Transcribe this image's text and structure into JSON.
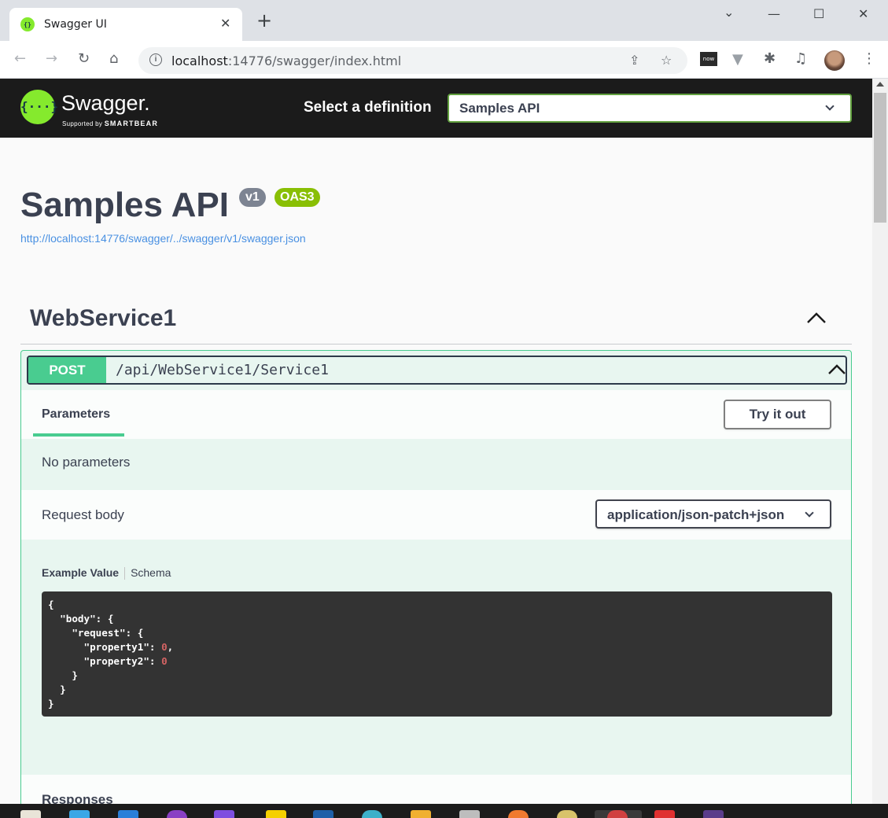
{
  "browser": {
    "tab_title": "Swagger UI",
    "tab_close": "✕",
    "new_tab": "+",
    "window_controls": {
      "minimize": "—",
      "maximize": "☐",
      "close": "✕",
      "tab_search": "⌄"
    },
    "url_host": "localhost",
    "url_rest": ":14776/swagger/index.html",
    "icons": [
      "back-icon",
      "forward-icon",
      "reload-icon",
      "home-icon",
      "info-icon",
      "share-icon",
      "star-icon",
      "extension-now-icon",
      "extension-v-icon",
      "puzzle-icon",
      "media-icon",
      "avatar",
      "menu-icon"
    ],
    "ext_now_label": "now"
  },
  "swagger": {
    "logo_mark": "{···}",
    "logo_name": "Swagger.",
    "logo_sub_prefix": "Supported by",
    "logo_sub_brand": "SMARTBEAR",
    "definition_label": "Select a definition",
    "definition_value": "Samples API",
    "brand_color": "#85ea2d"
  },
  "info": {
    "title": "Samples API",
    "version": "v1",
    "oas": "OAS3",
    "spec_url": "http://localhost:14776/swagger/../swagger/v1/swagger.json"
  },
  "tag": {
    "name": "WebService1",
    "expanded": true
  },
  "operation": {
    "method": "POST",
    "method_color": "#49cc90",
    "path": "/api/WebService1/Service1",
    "parameters_tab": "Parameters",
    "try_button": "Try it out",
    "no_parameters": "No parameters",
    "request_body_label": "Request body",
    "content_type": "application/json-patch+json",
    "example_tab": "Example Value",
    "schema_tab": "Schema",
    "example_code": {
      "l1": "{",
      "l2": "  \"body\": {",
      "l3": "    \"request\": {",
      "l4_key": "      \"property1\": ",
      "l4_val": "0",
      "l4_end": ",",
      "l5_key": "      \"property2\": ",
      "l5_val": "0",
      "l6": "    }",
      "l7": "  }",
      "l8": "}"
    },
    "responses_label": "Responses"
  }
}
